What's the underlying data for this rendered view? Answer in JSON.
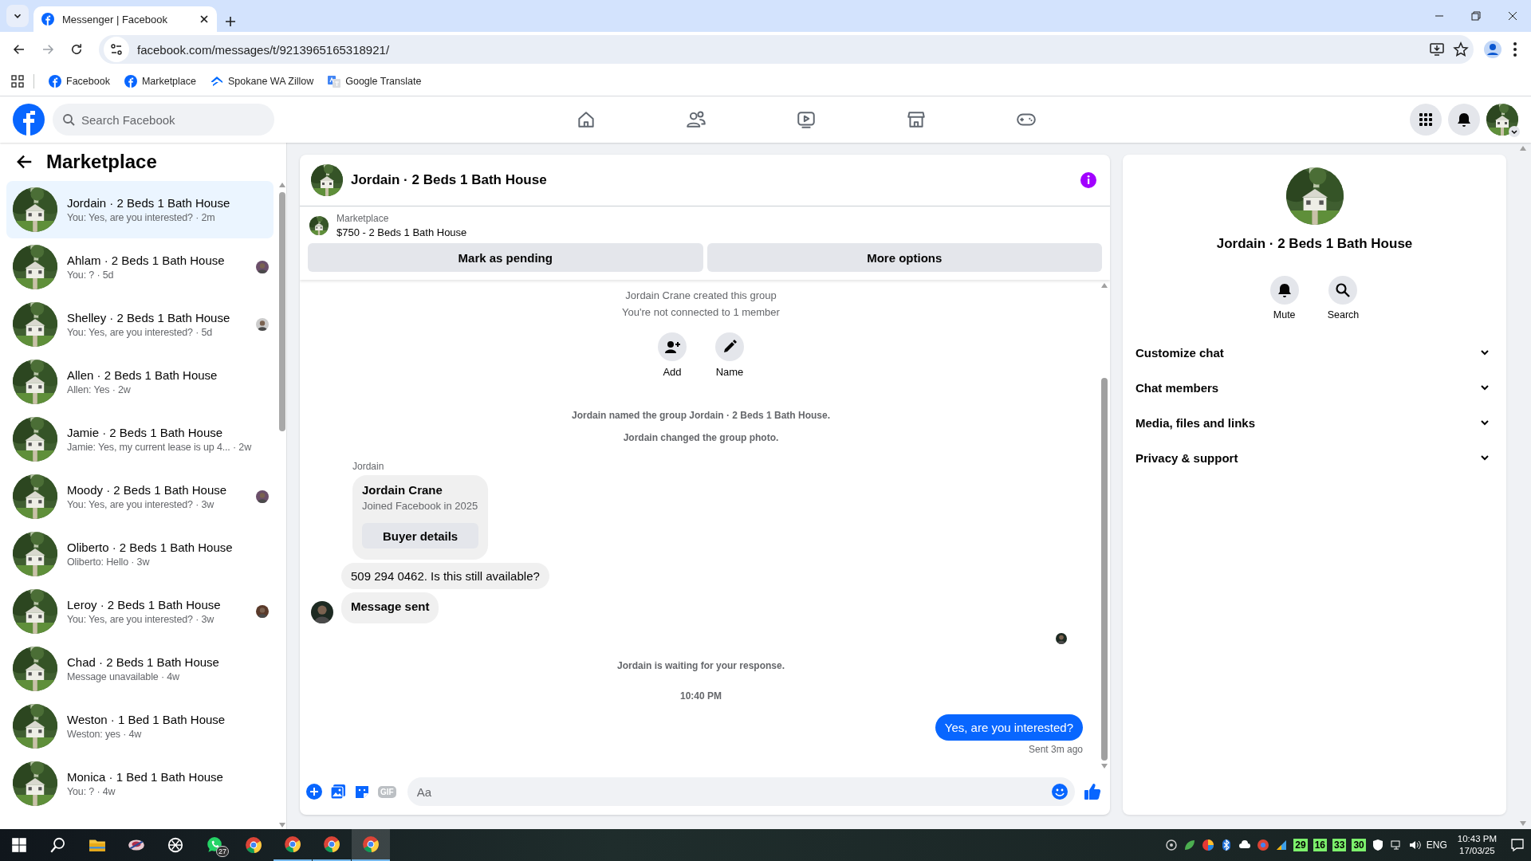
{
  "browser": {
    "tabs": [
      {
        "title": "Messenger | Facebook",
        "selected": true
      }
    ],
    "url": "facebook.com/messages/t/9213965165318921/",
    "bookmarks": [
      {
        "label": "Facebook",
        "kind": "facebook"
      },
      {
        "label": "Marketplace",
        "kind": "facebook"
      },
      {
        "label": "Spokane WA Zillow",
        "kind": "zillow"
      },
      {
        "label": "Google Translate",
        "kind": "translate"
      }
    ]
  },
  "topnav": {
    "search_placeholder": "Search Facebook"
  },
  "sidebar": {
    "title": "Marketplace",
    "conversations": [
      {
        "name": "Jordain · 2 Beds 1 Bath House",
        "preview": "You: Yes, are you interested? · 2m",
        "selected": true,
        "seen": false
      },
      {
        "name": "Ahlam · 2 Beds 1 Bath House",
        "preview": "You: ? · 5d",
        "selected": false,
        "seen": true
      },
      {
        "name": "Shelley · 2 Beds 1 Bath House",
        "preview": "You: Yes, are you interested? · 5d",
        "selected": false,
        "seen": true
      },
      {
        "name": "Allen · 2 Beds 1 Bath House",
        "preview": "Allen: Yes · 2w",
        "selected": false,
        "seen": false
      },
      {
        "name": "Jamie · 2 Beds 1 Bath House",
        "preview": "Jamie: Yes, my current lease is up 4... · 2w",
        "selected": false,
        "seen": false
      },
      {
        "name": "Moody · 2 Beds 1 Bath House",
        "preview": "You: Yes, are you interested? · 3w",
        "selected": false,
        "seen": true
      },
      {
        "name": "Oliberto · 2 Beds 1 Bath House",
        "preview": "Oliberto: Hello · 3w",
        "selected": false,
        "seen": false
      },
      {
        "name": "Leroy · 2 Beds 1 Bath House",
        "preview": "You: Yes, are you interested? · 3w",
        "selected": false,
        "seen": true
      },
      {
        "name": "Chad · 2 Beds 1 Bath House",
        "preview": "Message unavailable · 4w",
        "selected": false,
        "seen": false
      },
      {
        "name": "Weston · 1 Bed 1 Bath House",
        "preview": "Weston: yes · 4w",
        "selected": false,
        "seen": false
      },
      {
        "name": "Monica · 1 Bed 1 Bath House",
        "preview": "You: ? · 4w",
        "selected": false,
        "seen": false
      }
    ]
  },
  "chat": {
    "title": "Jordain · 2 Beds 1 Bath House",
    "listing": {
      "label": "Marketplace",
      "title": "$750 - 2 Beds 1 Bath House"
    },
    "buttons": [
      "Mark as pending",
      "More options"
    ],
    "messages": [
      {
        "kind": "notice",
        "text": "Jordain Crane created this group"
      },
      {
        "kind": "notice",
        "text": "You're not connected to 1 member"
      },
      {
        "kind": "actions",
        "items": [
          {
            "label": "Add",
            "kind": "add-person"
          },
          {
            "label": "Name",
            "kind": "pencil"
          }
        ]
      },
      {
        "kind": "event",
        "text": "Jordain named the group Jordain · 2 Beds 1 Bath House."
      },
      {
        "kind": "event",
        "text": "Jordain changed the group photo."
      },
      {
        "kind": "sender",
        "text": "Jordain"
      },
      {
        "kind": "card",
        "title": "Jordain Crane",
        "subtitle": "Joined Facebook in 2025",
        "button": "Buyer details"
      },
      {
        "kind": "incoming",
        "text": "509 294 0462. Is this still available?",
        "bold": false,
        "avatar": false
      },
      {
        "kind": "incoming",
        "text": "Message sent",
        "bold": true,
        "avatar": true
      },
      {
        "kind": "seen"
      },
      {
        "kind": "event",
        "text": "Jordain is waiting for your response."
      },
      {
        "kind": "time",
        "text": "10:40 PM"
      },
      {
        "kind": "outgoing",
        "text": "Yes, are you interested?",
        "status": "Sent 3m ago"
      }
    ],
    "composer": {
      "placeholder": "Aa",
      "gif_label": "GIF"
    }
  },
  "info": {
    "title": "Jordain · 2 Beds 1 Bath House",
    "actions": [
      {
        "label": "Mute",
        "kind": "bell"
      },
      {
        "label": "Search",
        "kind": "search"
      }
    ],
    "sections": [
      {
        "label": "Customize chat",
        "expanded": false
      },
      {
        "label": "Chat members",
        "expanded": false
      },
      {
        "label": "Media, files and links",
        "expanded": false
      },
      {
        "label": "Privacy & support",
        "expanded": false
      }
    ]
  },
  "taskbar": {
    "apps": [
      {
        "kind": "start",
        "selected": false,
        "open": false
      },
      {
        "kind": "search",
        "selected": false,
        "open": false
      },
      {
        "kind": "folder",
        "selected": false,
        "open": false
      },
      {
        "kind": "app",
        "selected": false,
        "open": false
      },
      {
        "kind": "knot",
        "selected": false,
        "open": false
      },
      {
        "kind": "chat",
        "badge": "27",
        "selected": false,
        "open": false
      },
      {
        "kind": "browser",
        "selected": false,
        "open": false
      },
      {
        "kind": "browser",
        "selected": false,
        "open": true
      },
      {
        "kind": "browser",
        "selected": false,
        "open": true
      },
      {
        "kind": "browser",
        "selected": true,
        "open": true
      }
    ],
    "counters": [
      "29",
      "16",
      "33",
      "30"
    ],
    "language": "ENG",
    "time": "10:43 PM",
    "date": "17/03/25"
  }
}
